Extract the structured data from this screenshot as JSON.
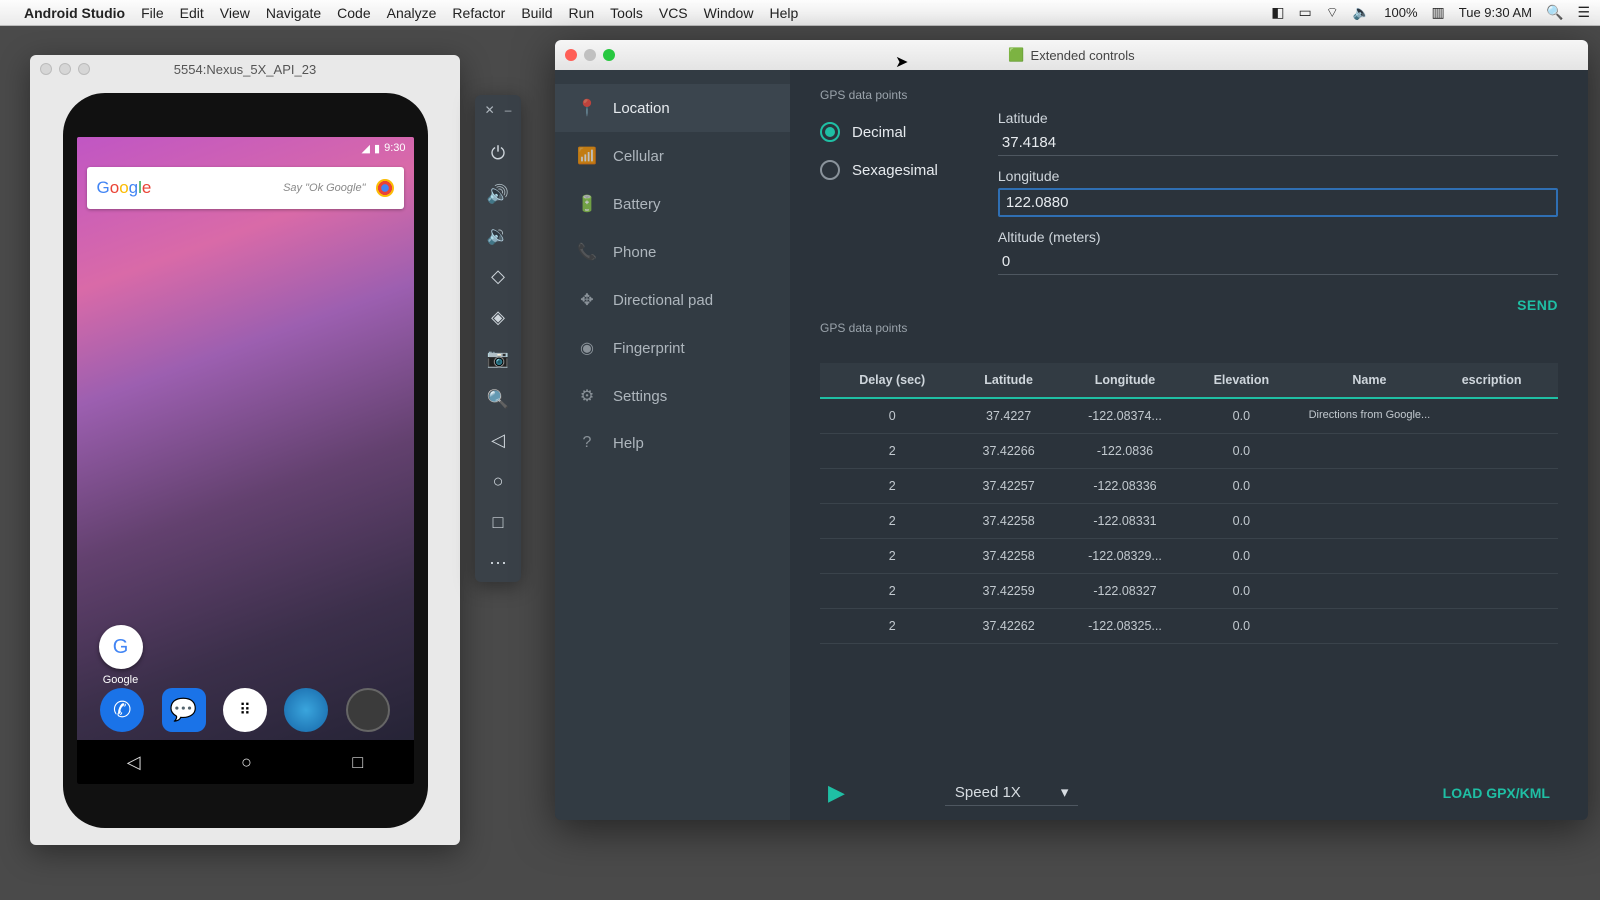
{
  "menubar": {
    "app": "Android Studio",
    "menus": [
      "File",
      "Edit",
      "View",
      "Navigate",
      "Code",
      "Analyze",
      "Refactor",
      "Build",
      "Run",
      "Tools",
      "VCS",
      "Window",
      "Help"
    ],
    "battery_pct": "100%",
    "clock": "Tue 9:30 AM"
  },
  "emulator": {
    "title": "5554:Nexus_5X_API_23",
    "status_time": "9:30",
    "search_hint": "Say \"Ok Google\"",
    "google_icon_label": "Google"
  },
  "sidebar_icons": [
    "power",
    "volume-up",
    "volume-down",
    "rotate-left",
    "rotate-right",
    "camera",
    "zoom",
    "back",
    "home",
    "recents",
    "more"
  ],
  "extended": {
    "window_title": "Extended controls",
    "nav": [
      {
        "icon": "📍",
        "label": "Location",
        "active": true
      },
      {
        "icon": "📶",
        "label": "Cellular"
      },
      {
        "icon": "🔋",
        "label": "Battery"
      },
      {
        "icon": "📞",
        "label": "Phone"
      },
      {
        "icon": "✥",
        "label": "Directional pad"
      },
      {
        "icon": "◉",
        "label": "Fingerprint"
      },
      {
        "icon": "⚙",
        "label": "Settings"
      },
      {
        "icon": "?",
        "label": "Help"
      }
    ],
    "gps_section_label": "GPS data points",
    "format": {
      "decimal": "Decimal",
      "sexagesimal": "Sexagesimal",
      "selected": "decimal"
    },
    "fields": {
      "latitude_label": "Latitude",
      "latitude": "37.4184",
      "longitude_label": "Longitude",
      "longitude": "122.0880",
      "altitude_label": "Altitude (meters)",
      "altitude": "0"
    },
    "send_label": "SEND",
    "table_section_label": "GPS data points",
    "headers": [
      "Delay (sec)",
      "Latitude",
      "Longitude",
      "Elevation",
      "Name",
      "escription"
    ],
    "rows": [
      {
        "delay": "0",
        "lat": "37.4227",
        "lon": "-122.08374...",
        "elev": "0.0",
        "name": "Directions from Google...",
        "desc": ""
      },
      {
        "delay": "2",
        "lat": "37.42266",
        "lon": "-122.0836",
        "elev": "0.0",
        "name": "",
        "desc": ""
      },
      {
        "delay": "2",
        "lat": "37.42257",
        "lon": "-122.08336",
        "elev": "0.0",
        "name": "",
        "desc": ""
      },
      {
        "delay": "2",
        "lat": "37.42258",
        "lon": "-122.08331",
        "elev": "0.0",
        "name": "",
        "desc": ""
      },
      {
        "delay": "2",
        "lat": "37.42258",
        "lon": "-122.08329...",
        "elev": "0.0",
        "name": "",
        "desc": ""
      },
      {
        "delay": "2",
        "lat": "37.42259",
        "lon": "-122.08327",
        "elev": "0.0",
        "name": "",
        "desc": ""
      },
      {
        "delay": "2",
        "lat": "37.42262",
        "lon": "-122.08325...",
        "elev": "0.0",
        "name": "",
        "desc": ""
      }
    ],
    "speed_label": "Speed 1X",
    "load_label": "LOAD GPX/KML"
  }
}
